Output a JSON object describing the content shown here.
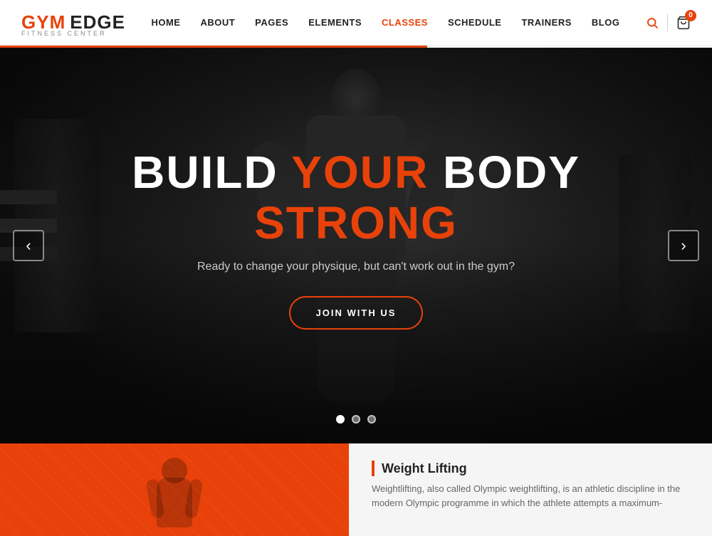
{
  "logo": {
    "gym": "GYM",
    "edge": "EDGE",
    "sub": "FITNESS CENTER"
  },
  "nav": {
    "items": [
      {
        "label": "HOME",
        "id": "home"
      },
      {
        "label": "ABOUT",
        "id": "about"
      },
      {
        "label": "PAGES",
        "id": "pages"
      },
      {
        "label": "ELEMENTS",
        "id": "elements"
      },
      {
        "label": "CLASSES",
        "id": "classes"
      },
      {
        "label": "SCHEDULE",
        "id": "schedule"
      },
      {
        "label": "TRAINERS",
        "id": "trainers"
      },
      {
        "label": "BLOG",
        "id": "blog"
      }
    ],
    "cart_count": "0"
  },
  "hero": {
    "title_part1": "BUILD ",
    "title_part2": "YOUR",
    "title_part3": " BODY ",
    "title_part4": "STRONG",
    "subtitle": "Ready to change your physique, but can't work out in the gym?",
    "btn_label": "JOIN WITH US",
    "prev_label": "‹",
    "next_label": "›"
  },
  "bottom": {
    "section_title": "Weight Lifting",
    "section_text": "Weightlifting, also called Olympic weightlifting, is an athletic discipline in the modern Olympic programme in which the athlete attempts a maximum-"
  },
  "colors": {
    "accent": "#e8420a",
    "white": "#ffffff",
    "dark": "#222222"
  }
}
